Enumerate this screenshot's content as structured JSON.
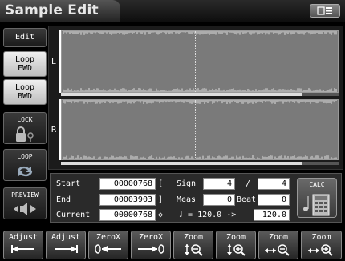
{
  "window": {
    "title": "Sample Edit",
    "menu_icon": "menu-icon"
  },
  "side": {
    "edit": "Edit",
    "loop_fwd_1": "Loop",
    "loop_fwd_2": "FWD",
    "loop_bwd_1": "Loop",
    "loop_bwd_2": "BWD",
    "lock": "LOCK",
    "loop": "LOOP",
    "preview": "PREVIEW"
  },
  "channels": {
    "left": "L",
    "right": "R"
  },
  "params": {
    "start_label": "Start",
    "start_value": "00000768",
    "start_sym": "[",
    "end_label": "End",
    "end_value": "00003903",
    "end_sym": "]",
    "current_label": "Current",
    "current_value": "00000768",
    "current_sym": "◇",
    "sign_label": "Sign",
    "sign_num": "4",
    "sign_sep": "/",
    "sign_den": "4",
    "meas_label": "Meas",
    "meas_value": "0",
    "beat_label": "Beat",
    "beat_value": "0",
    "tempo_text": "♩ = 120.0 ->",
    "tempo_value": "120.0"
  },
  "calc": {
    "label": "CALC"
  },
  "fkeys": {
    "f1": "Adjust",
    "f2": "Adjust",
    "f3": "ZeroX",
    "f4": "ZeroX",
    "f5": "Zoom",
    "f6": "Zoom",
    "f7": "Zoom",
    "f8": "Zoom"
  }
}
